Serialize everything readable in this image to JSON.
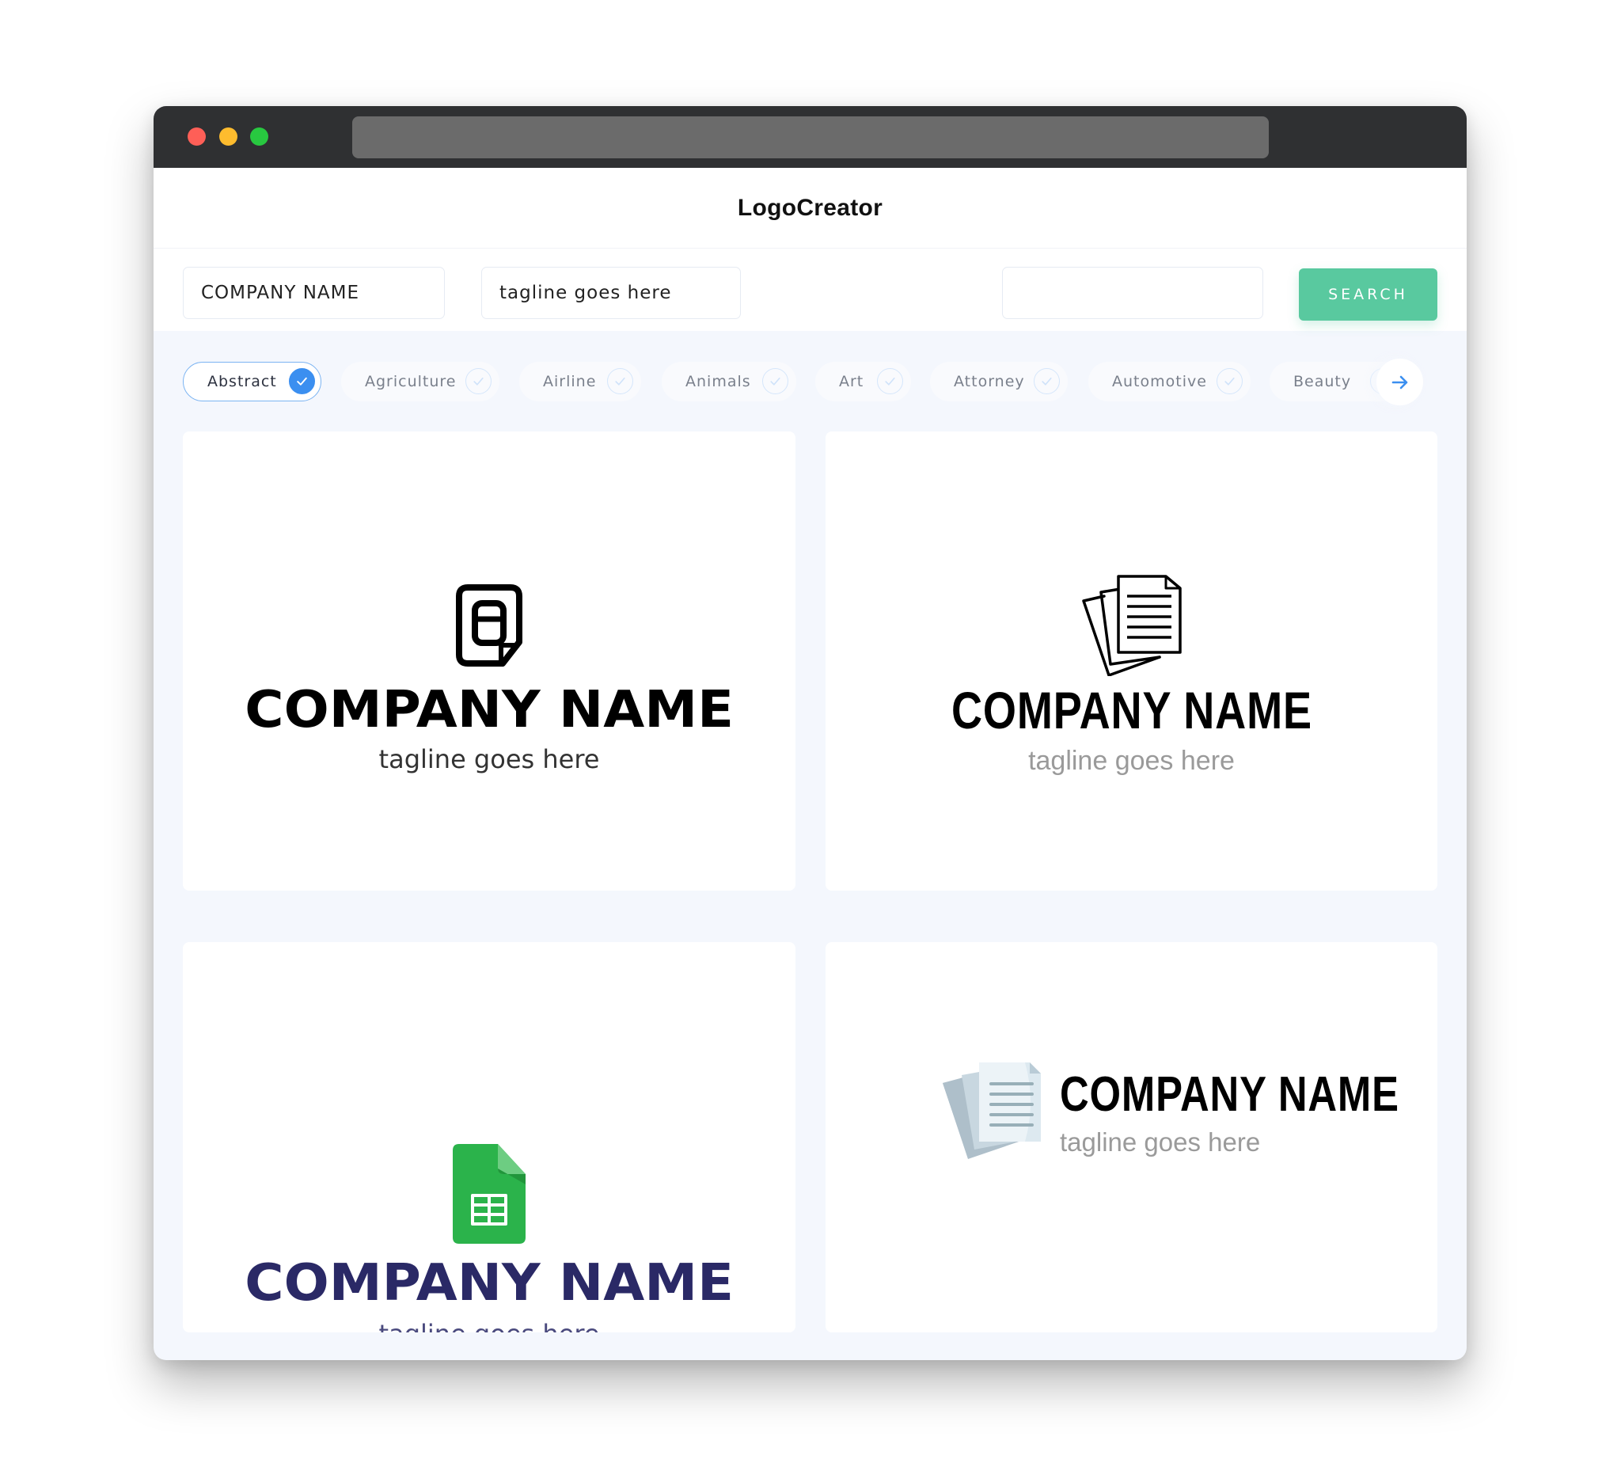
{
  "window": {
    "controls": [
      "close",
      "minimize",
      "maximize"
    ],
    "address_bar_value": ""
  },
  "header": {
    "brand": "LogoCreator"
  },
  "search": {
    "company_name_value": "COMPANY NAME",
    "tagline_value": "tagline goes here",
    "keyword_value": "",
    "button_label": "SEARCH"
  },
  "categories": {
    "items": [
      {
        "label": "Abstract",
        "selected": true
      },
      {
        "label": "Agriculture",
        "selected": false
      },
      {
        "label": "Airline",
        "selected": false
      },
      {
        "label": "Animals",
        "selected": false
      },
      {
        "label": "Art",
        "selected": false
      },
      {
        "label": "Attorney",
        "selected": false
      },
      {
        "label": "Automotive",
        "selected": false
      },
      {
        "label": "Beauty",
        "selected": false
      }
    ],
    "next_icon": "arrow-right-icon"
  },
  "logos": [
    {
      "icon": "locked-document-icon",
      "name": "COMPANY NAME",
      "tagline": "tagline goes here",
      "name_color": "#000000",
      "tagline_color": "#333333",
      "layout": "stacked"
    },
    {
      "icon": "stacked-documents-outline-icon",
      "name": "COMPANY NAME",
      "tagline": "tagline goes here",
      "name_color": "#000000",
      "tagline_color": "#9a9a9a",
      "layout": "stacked"
    },
    {
      "icon": "spreadsheet-document-icon",
      "name": "COMPANY NAME",
      "tagline": "tagline goes here",
      "name_color": "#2a2966",
      "tagline_color": "#4a4a7e",
      "layout": "stacked"
    },
    {
      "icon": "stacked-documents-flat-icon",
      "name": "COMPANY NAME",
      "tagline": "tagline goes here",
      "name_color": "#000000",
      "tagline_color": "#9a9a9a",
      "layout": "inline"
    }
  ],
  "colors": {
    "accent": "#59c99f",
    "selected_chip": "#3b8ff0",
    "titlebar": "#2f3032",
    "page_bg": "#f4f7fd"
  }
}
